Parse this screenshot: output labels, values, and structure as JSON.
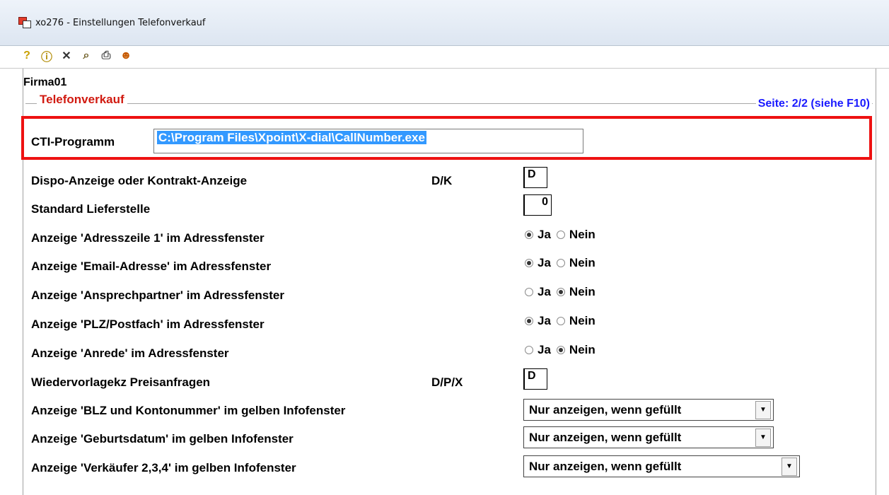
{
  "window": {
    "title": "xo276 - Einstellungen Telefonverkauf"
  },
  "toolbar": {
    "icons": [
      "help-icon",
      "info-icon",
      "close-icon",
      "binoculars-icon",
      "print-icon",
      "user-icon"
    ],
    "glyphs": [
      "?",
      "ⓘ",
      "✕",
      "⌕",
      "⎙",
      "☻"
    ]
  },
  "firma": "Firma01",
  "group": {
    "title": "Telefonverkauf",
    "page_indicator": "Seite: 2/2 (siehe F10)"
  },
  "cti": {
    "label": "CTI-Programm",
    "value": "C:\\Program Files\\Xpoint\\X-dial\\CallNumber.exe"
  },
  "rows": {
    "dispo": {
      "label": "Dispo-Anzeige oder Kontrakt-Anzeige",
      "hint": "D/K",
      "value": "D"
    },
    "lieferstelle": {
      "label": "Standard Lieferstelle",
      "value": "0"
    },
    "adresszeile": {
      "label": "Anzeige 'Adresszeile 1' im Adressfenster",
      "selected": "Ja"
    },
    "email": {
      "label": "Anzeige 'Email-Adresse' im Adressfenster",
      "selected": "Ja"
    },
    "ansprech": {
      "label": "Anzeige 'Ansprechpartner' im Adressfenster",
      "selected": "Nein"
    },
    "plz": {
      "label": "Anzeige 'PLZ/Postfach' im Adressfenster",
      "selected": "Ja"
    },
    "anrede": {
      "label": "Anzeige 'Anrede' im Adressfenster",
      "selected": "Nein"
    },
    "wiedervorlage": {
      "label": "Wiedervorlagekz Preisanfragen",
      "hint": "D/P/X",
      "value": "D"
    },
    "blz": {
      "label": "Anzeige 'BLZ und Kontonummer' im gelben Infofenster",
      "value": "Nur anzeigen, wenn gefüllt"
    },
    "geburt": {
      "label": "Anzeige 'Geburtsdatum' im gelben Infofenster",
      "value": "Nur anzeigen, wenn gefüllt"
    },
    "verkaeufer": {
      "label": "Anzeige 'Verkäufer 2,3,4' im gelben Infofenster",
      "value": "Nur anzeigen, wenn gefüllt"
    }
  },
  "radio_labels": {
    "yes": "Ja",
    "no": "Nein"
  }
}
